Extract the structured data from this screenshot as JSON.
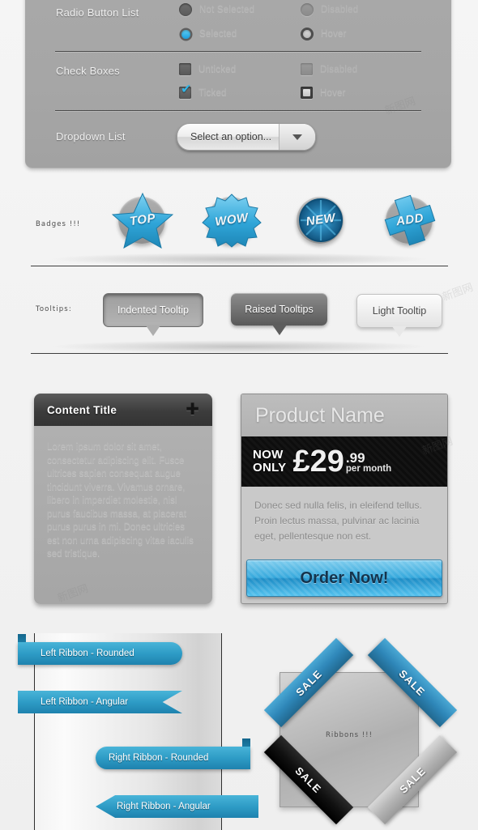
{
  "form_panel": {
    "rows": [
      {
        "label": "Radio Button List",
        "controls": [
          {
            "name": "radio-not-selected",
            "state": "default",
            "text": "Not Selected"
          },
          {
            "name": "radio-disabled",
            "state": "disabled",
            "text": "Disabled"
          },
          {
            "name": "radio-selected",
            "state": "selected",
            "text": "Selected"
          },
          {
            "name": "radio-hover",
            "state": "hover",
            "text": "Hover"
          }
        ]
      },
      {
        "label": "Check Boxes",
        "controls": [
          {
            "name": "checkbox-unticked",
            "state": "default",
            "text": "Unticked"
          },
          {
            "name": "checkbox-disabled",
            "state": "disabled",
            "text": "Disabled"
          },
          {
            "name": "checkbox-ticked",
            "state": "ticked",
            "text": "Ticked"
          },
          {
            "name": "checkbox-hover",
            "state": "hover",
            "text": "Hover"
          }
        ]
      },
      {
        "label": "Dropdown List",
        "select_value": "Select an option...",
        "select_placeholder": "Select an option..."
      }
    ]
  },
  "badges": {
    "section_label": "Badges !!!",
    "items": [
      {
        "text": "TOP",
        "shape": "star",
        "icon": "badge-star-icon"
      },
      {
        "text": "WOW",
        "shape": "burst",
        "icon": "badge-burst-icon"
      },
      {
        "text": "NEW",
        "shape": "circle",
        "icon": "badge-circle-icon"
      },
      {
        "text": "ADD",
        "shape": "cross",
        "icon": "badge-cross-icon"
      }
    ]
  },
  "tooltips": {
    "section_label": "Tooltips:",
    "items": [
      {
        "text": "Indented Tooltip",
        "style": "indented"
      },
      {
        "text": "Raised Tooltips",
        "style": "raised"
      },
      {
        "text": "Light Tooltip",
        "style": "light"
      }
    ]
  },
  "content_box": {
    "title": "Content Title",
    "toggle_icon": "plus-icon",
    "body": "Lorem ipsum dolor sit amet, consectetur adipiscing elit. Fusce ultrices sapien consequat augue tincidunt viverra. Vivamus ornare, libero in imperdiet molestie, nisl purus faucibus massa, at placerat purus purus in mi. Donec ultricies est non urna adipiscing vitae iaculis sed tristique."
  },
  "pricing": {
    "product_name": "Product Name",
    "now_line1": "NOW",
    "now_line2": "ONLY",
    "currency_amount": "£29",
    "cents": ".99",
    "period": "per month",
    "description": "Donec sed nulla felis, in eleifend tellus. Proin lectus massa, pulvinar ac lacinia eget, pellentesque non est.",
    "cta_label": "Order Now!"
  },
  "ribbons": {
    "left": [
      {
        "text": "Left Ribbon - Rounded",
        "side": "left",
        "shape": "rounded"
      },
      {
        "text": "Left Ribbon - Angular",
        "side": "left",
        "shape": "angular"
      },
      {
        "text": "Right Ribbon - Rounded",
        "side": "right",
        "shape": "rounded"
      },
      {
        "text": "Right Ribbon - Angular",
        "side": "right",
        "shape": "angular"
      }
    ],
    "corner_box": {
      "center_label": "Ribbons !!!",
      "corners": [
        {
          "text": "SALE",
          "position": "top-left",
          "color": "blue"
        },
        {
          "text": "SALE",
          "position": "top-right",
          "color": "blue"
        },
        {
          "text": "SALE",
          "position": "bottom-left",
          "color": "black"
        },
        {
          "text": "SALE",
          "position": "bottom-right",
          "color": "gray"
        }
      ]
    }
  },
  "colors": {
    "accent_blue": "#2e9cc6",
    "panel_gray": "#a8a8a8",
    "dark": "#111111",
    "page_bg": "#f2f2f2"
  }
}
